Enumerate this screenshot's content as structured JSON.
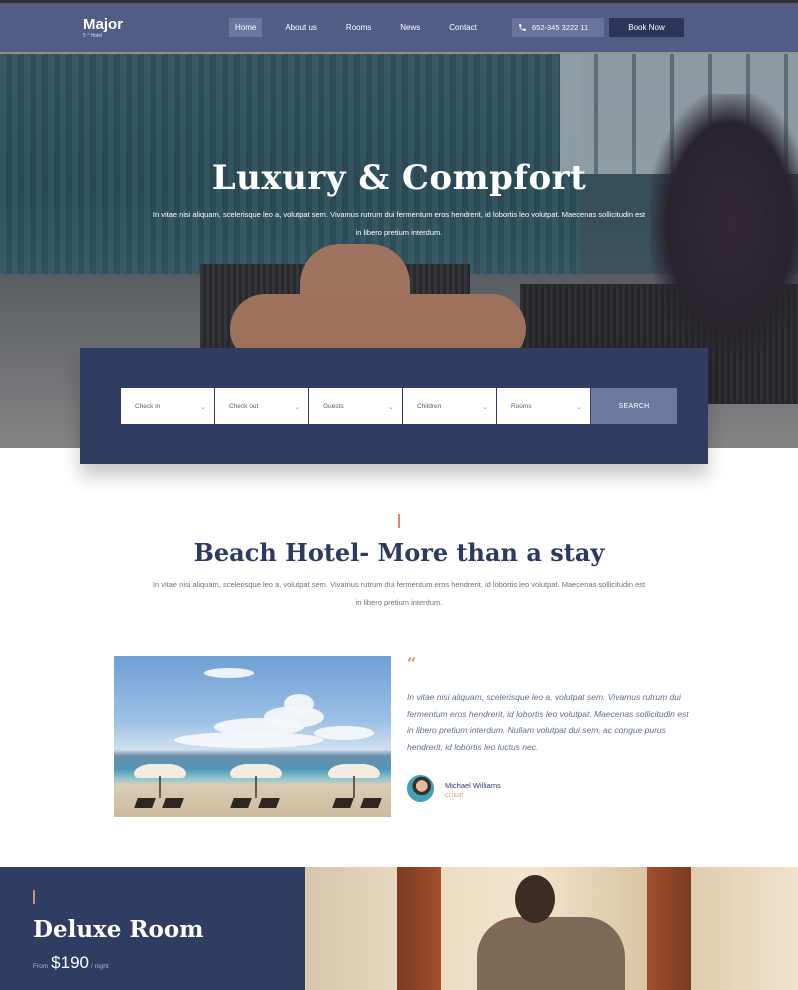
{
  "header": {
    "logo_name": "Major",
    "logo_sub": "5 * Hotel",
    "nav": [
      "Home",
      "About us",
      "Rooms",
      "News",
      "Contact"
    ],
    "active_nav": "Home",
    "phone": "652-345 3222 11",
    "book_label": "Book Now"
  },
  "hero": {
    "title": "Luxury & Compfort",
    "text": "In vitae nisi aliquam, scelerisque leo a, volutpat sem. Vivamus rutrum dui fermentum eros hendrerit, id lobortis leo volutpat. Maecenas sollicitudin est in libero pretium interdum."
  },
  "booking": {
    "fields": [
      "Check in",
      "Check out",
      "Guests",
      "Children",
      "Rooms"
    ],
    "search_label": "SEARCH"
  },
  "intro": {
    "title": "Beach Hotel- More than a stay",
    "text": "In vitae nisi aliquam, scelerisque leo a, volutpat sem. Vivamus rutrum dui fermentum eros hendrerit, id lobortis leo volutpat. Maecenas sollicitudin est in libero pretium interdum."
  },
  "testimonial": {
    "quote_mark": "“",
    "quote": "In vitae nisi aliquam, scelerisque leo a, volutpat sem. Vivamus rutrum dui fermentum eros hendrerit, id lobortis leo volutpat. Maecenas sollicitudin est in libero pretium interdum. Nullam volutpat dui sem, ac congue purus hendrerit, id lobortis leo luctus nec.",
    "author": "Michael Williams",
    "role": "CLIENT"
  },
  "deluxe": {
    "title": "Deluxe Room",
    "from_label": "From",
    "price": "$190",
    "per_label": "/ night"
  },
  "colors": {
    "header": "#525d86",
    "navy": "#303d63",
    "accent": "#d88c65",
    "search_button": "#6e79a0"
  },
  "icons": {
    "phone": "phone-icon",
    "chevron": "chevron-down-icon",
    "quote": "quote-icon"
  }
}
